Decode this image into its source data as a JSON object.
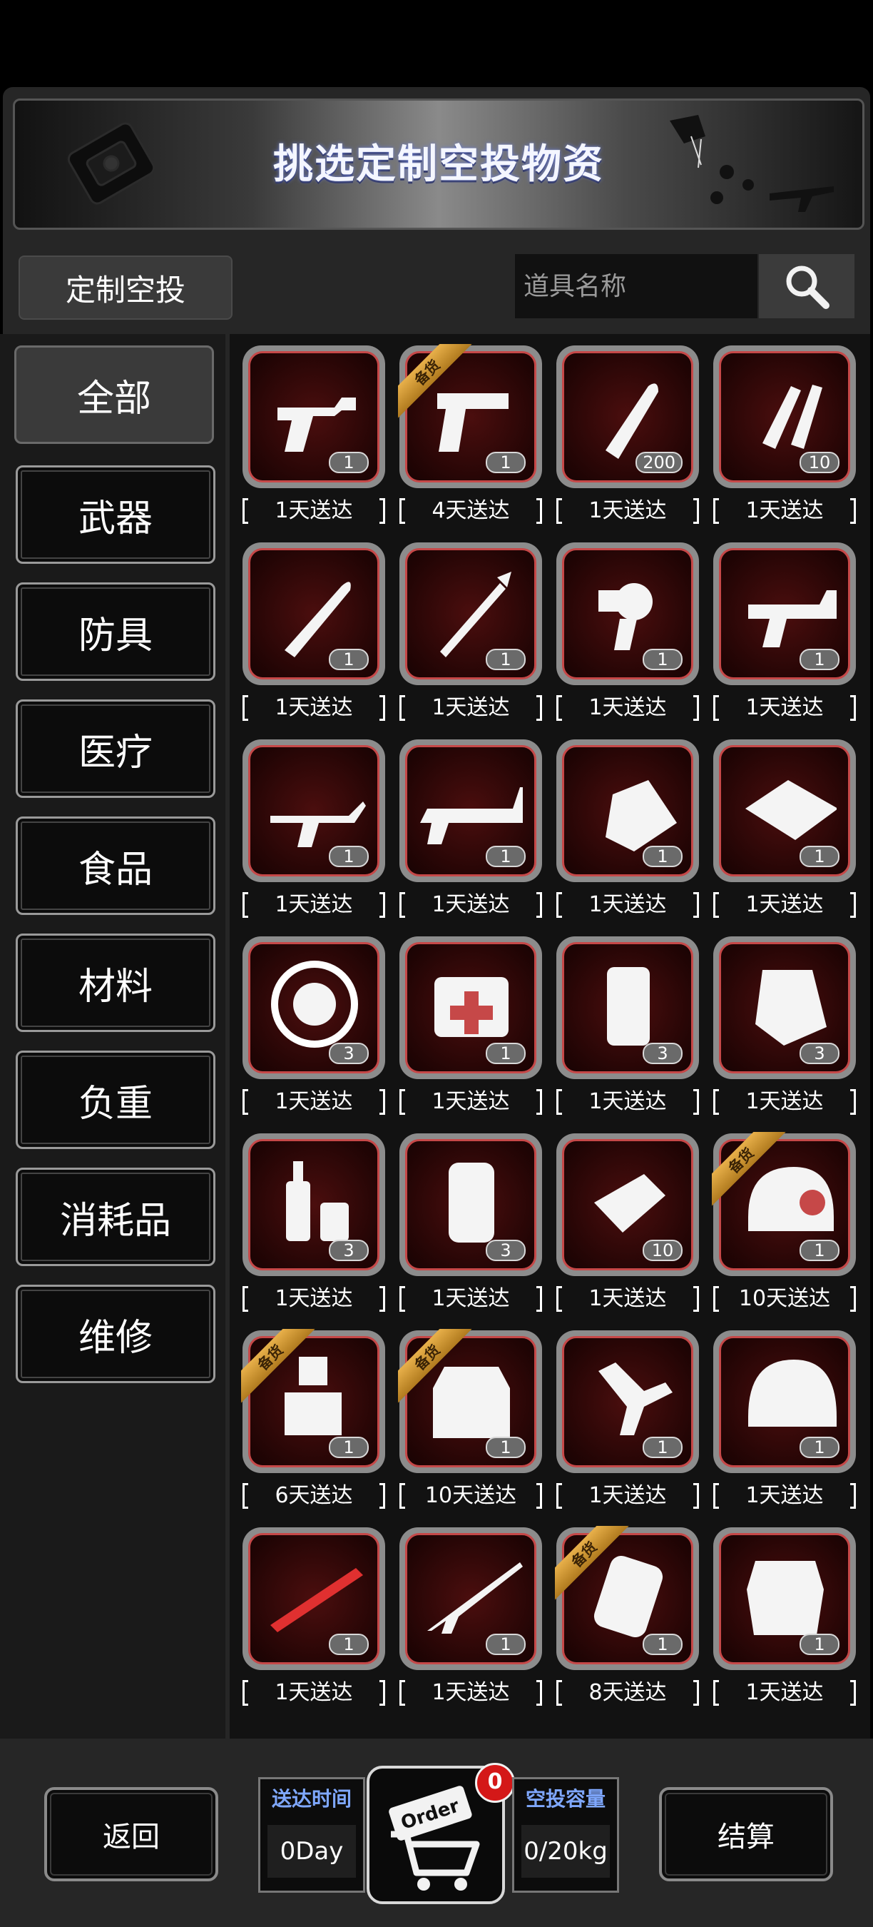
{
  "banner": {
    "title": "挑选定制空投物资"
  },
  "header": {
    "tab_label": "定制空投",
    "search_placeholder": "道具名称"
  },
  "sidebar": {
    "categories": [
      "全部",
      "武器",
      "防具",
      "医疗",
      "食品",
      "材料",
      "负重",
      "消耗品",
      "维修"
    ],
    "active": "全部"
  },
  "ribbon_label": "备货",
  "items": [
    {
      "icon": "revolver-icon",
      "qty": "1",
      "delivery": "1天送达",
      "ribbon": false
    },
    {
      "icon": "pistol-icon",
      "qty": "1",
      "delivery": "4天送达",
      "ribbon": true
    },
    {
      "icon": "bullet-icon",
      "qty": "200",
      "delivery": "1天送达",
      "ribbon": false
    },
    {
      "icon": "shotgun-shells-icon",
      "qty": "10",
      "delivery": "1天送达",
      "ribbon": false
    },
    {
      "icon": "knife-icon",
      "qty": "1",
      "delivery": "1天送达",
      "ribbon": false
    },
    {
      "icon": "spear-icon",
      "qty": "1",
      "delivery": "1天送达",
      "ribbon": false
    },
    {
      "icon": "ray-gun-icon",
      "qty": "1",
      "delivery": "1天送达",
      "ribbon": false
    },
    {
      "icon": "blaster-icon",
      "qty": "1",
      "delivery": "1天送达",
      "ribbon": false
    },
    {
      "icon": "assault-rifle-icon",
      "qty": "1",
      "delivery": "1天送达",
      "ribbon": false
    },
    {
      "icon": "heavy-gun-icon",
      "qty": "1",
      "delivery": "1天送达",
      "ribbon": false
    },
    {
      "icon": "spray-bottle-icon",
      "qty": "1",
      "delivery": "1天送达",
      "ribbon": false
    },
    {
      "icon": "tool-box-icon",
      "qty": "1",
      "delivery": "1天送达",
      "ribbon": false
    },
    {
      "icon": "food-plate-icon",
      "qty": "3",
      "delivery": "1天送达",
      "ribbon": false
    },
    {
      "icon": "medkit-icon",
      "qty": "1",
      "delivery": "1天送达",
      "ribbon": false
    },
    {
      "icon": "coffee-can-icon",
      "qty": "3",
      "delivery": "1天送达",
      "ribbon": false
    },
    {
      "icon": "chocolate-icon",
      "qty": "3",
      "delivery": "1天送达",
      "ribbon": false
    },
    {
      "icon": "bottle-and-glass-icon",
      "qty": "3",
      "delivery": "1天送达",
      "ribbon": false
    },
    {
      "icon": "beer-can-icon",
      "qty": "3",
      "delivery": "1天送达",
      "ribbon": false
    },
    {
      "icon": "cloth-icon",
      "qty": "10",
      "delivery": "1天送达",
      "ribbon": false
    },
    {
      "icon": "armored-helmet-icon",
      "qty": "1",
      "delivery": "10天送达",
      "ribbon": true
    },
    {
      "icon": "tactical-rig-icon",
      "qty": "1",
      "delivery": "6天送达",
      "ribbon": true
    },
    {
      "icon": "armor-vest-icon",
      "qty": "1",
      "delivery": "10天送达",
      "ribbon": true
    },
    {
      "icon": "parts-icon",
      "qty": "1",
      "delivery": "1天送达",
      "ribbon": false
    },
    {
      "icon": "combat-helmet-icon",
      "qty": "1",
      "delivery": "1天送达",
      "ribbon": false
    },
    {
      "icon": "rocket-launcher-icon",
      "qty": "1",
      "delivery": "1天送达",
      "ribbon": false
    },
    {
      "icon": "sniper-rifle-icon",
      "qty": "1",
      "delivery": "1天送达",
      "ribbon": false
    },
    {
      "icon": "backpack-icon",
      "qty": "1",
      "delivery": "8天送达",
      "ribbon": true
    },
    {
      "icon": "body-armor-icon",
      "qty": "1",
      "delivery": "1天送达",
      "ribbon": false
    }
  ],
  "bottom": {
    "back_label": "返回",
    "delivery_time_label": "送达时间",
    "delivery_time_value": "0Day",
    "order_label": "Order",
    "order_badge": "0",
    "capacity_label": "空投容量",
    "capacity_value": "0/20kg",
    "checkout_label": "结算"
  },
  "colors": {
    "accent_red": "#c64848",
    "label_blue": "#7fa8ff",
    "ribbon_gold": "#d89a34"
  }
}
